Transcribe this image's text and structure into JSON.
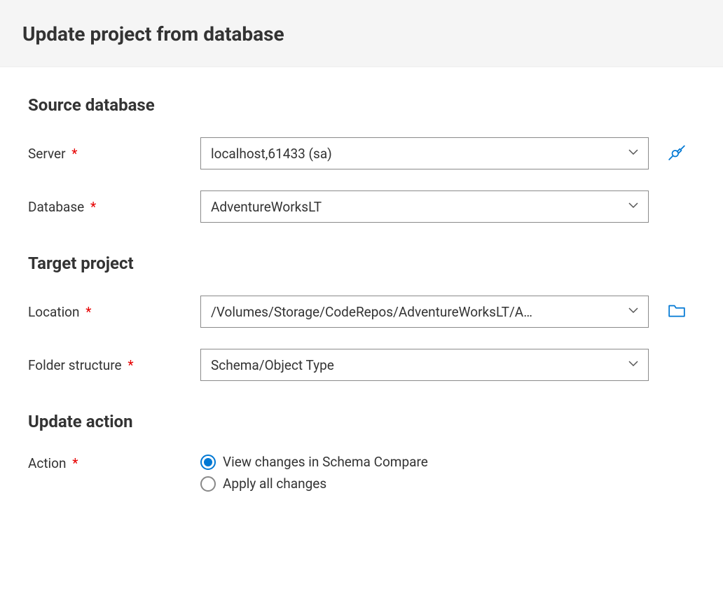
{
  "header": {
    "title": "Update project from database"
  },
  "sections": {
    "source": {
      "title": "Source database",
      "serverLabel": "Server",
      "serverValue": "localhost,61433 (sa)",
      "databaseLabel": "Database",
      "databaseValue": "AdventureWorksLT"
    },
    "target": {
      "title": "Target project",
      "locationLabel": "Location",
      "locationValue": "/Volumes/Storage/CodeRepos/AdventureWorksLT/A…",
      "folderLabel": "Folder structure",
      "folderValue": "Schema/Object Type"
    },
    "action": {
      "title": "Update action",
      "actionLabel": "Action",
      "option1": "View changes in Schema Compare",
      "option2": "Apply all changes"
    }
  },
  "colors": {
    "accent": "#0078d4",
    "required": "#e60000"
  }
}
